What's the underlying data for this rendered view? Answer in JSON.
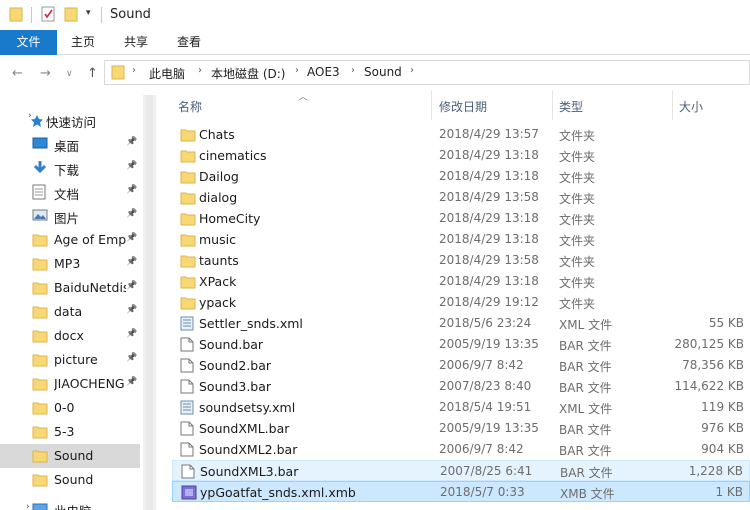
{
  "window": {
    "title": "Sound"
  },
  "ribbon": {
    "tabs": [
      "文件",
      "主页",
      "共享",
      "查看"
    ]
  },
  "address": {
    "crumbs": [
      "此电脑",
      "本地磁盘 (D:)",
      "AOE3",
      "Sound"
    ]
  },
  "nav": {
    "quick_access": "快速访问",
    "items": [
      {
        "label": "桌面",
        "icon": "desktop-icon",
        "pinned": true
      },
      {
        "label": "下载",
        "icon": "download-icon",
        "pinned": true
      },
      {
        "label": "文档",
        "icon": "document-icon",
        "pinned": true
      },
      {
        "label": "图片",
        "icon": "picture-icon",
        "pinned": true
      },
      {
        "label": "Age of Emp",
        "icon": "folder-icon",
        "pinned": true
      },
      {
        "label": "MP3",
        "icon": "folder-icon",
        "pinned": true
      },
      {
        "label": "BaiduNetdis",
        "icon": "folder-icon",
        "pinned": true
      },
      {
        "label": "data",
        "icon": "folder-icon",
        "pinned": true
      },
      {
        "label": "docx",
        "icon": "folder-icon",
        "pinned": true
      },
      {
        "label": "picture",
        "icon": "folder-icon",
        "pinned": true
      },
      {
        "label": "JIAOCHENG",
        "icon": "folder-icon",
        "pinned": true
      },
      {
        "label": "0-0",
        "icon": "folder-icon",
        "pinned": false
      },
      {
        "label": "5-3",
        "icon": "folder-icon",
        "pinned": false
      },
      {
        "label": "Sound",
        "icon": "folder-icon",
        "pinned": false
      },
      {
        "label": "Sound",
        "icon": "folder-icon",
        "pinned": false
      }
    ],
    "this_pc": "此电脑"
  },
  "columns": {
    "name": "名称",
    "date": "修改日期",
    "type": "类型",
    "size": "大小"
  },
  "files": [
    {
      "name": "Chats",
      "date": "2018/4/29 13:57",
      "type": "文件夹",
      "size": "",
      "icon": "folder-icon"
    },
    {
      "name": "cinematics",
      "date": "2018/4/29 13:18",
      "type": "文件夹",
      "size": "",
      "icon": "folder-icon"
    },
    {
      "name": "Dailog",
      "date": "2018/4/29 13:18",
      "type": "文件夹",
      "size": "",
      "icon": "folder-icon"
    },
    {
      "name": "dialog",
      "date": "2018/4/29 13:58",
      "type": "文件夹",
      "size": "",
      "icon": "folder-icon"
    },
    {
      "name": "HomeCity",
      "date": "2018/4/29 13:18",
      "type": "文件夹",
      "size": "",
      "icon": "folder-icon"
    },
    {
      "name": "music",
      "date": "2018/4/29 13:18",
      "type": "文件夹",
      "size": "",
      "icon": "folder-icon"
    },
    {
      "name": "taunts",
      "date": "2018/4/29 13:58",
      "type": "文件夹",
      "size": "",
      "icon": "folder-icon"
    },
    {
      "name": "XPack",
      "date": "2018/4/29 13:18",
      "type": "文件夹",
      "size": "",
      "icon": "folder-icon"
    },
    {
      "name": "ypack",
      "date": "2018/4/29 19:12",
      "type": "文件夹",
      "size": "",
      "icon": "folder-icon"
    },
    {
      "name": "Settler_snds.xml",
      "date": "2018/5/6 23:24",
      "type": "XML 文件",
      "size": "55 KB",
      "icon": "xml-file-icon"
    },
    {
      "name": "Sound.bar",
      "date": "2005/9/19 13:35",
      "type": "BAR 文件",
      "size": "280,125 KB",
      "icon": "file-icon"
    },
    {
      "name": "Sound2.bar",
      "date": "2006/9/7 8:42",
      "type": "BAR 文件",
      "size": "78,356 KB",
      "icon": "file-icon"
    },
    {
      "name": "Sound3.bar",
      "date": "2007/8/23 8:40",
      "type": "BAR 文件",
      "size": "114,622 KB",
      "icon": "file-icon"
    },
    {
      "name": "soundsetsy.xml",
      "date": "2018/5/4 19:51",
      "type": "XML 文件",
      "size": "119 KB",
      "icon": "xml-file-icon"
    },
    {
      "name": "SoundXML.bar",
      "date": "2005/9/19 13:35",
      "type": "BAR 文件",
      "size": "976 KB",
      "icon": "file-icon"
    },
    {
      "name": "SoundXML2.bar",
      "date": "2006/9/7 8:42",
      "type": "BAR 文件",
      "size": "904 KB",
      "icon": "file-icon"
    },
    {
      "name": "SoundXML3.bar",
      "date": "2007/8/25 6:41",
      "type": "BAR 文件",
      "size": "1,228 KB",
      "icon": "file-icon"
    },
    {
      "name": "ypGoatfat_snds.xml.xmb",
      "date": "2018/5/7 0:33",
      "type": "XMB 文件",
      "size": "1 KB",
      "icon": "xmb-file-icon"
    }
  ],
  "colors": {
    "accent": "#1979ca",
    "selection": "#cce8ff",
    "folder": "#f8d775"
  }
}
